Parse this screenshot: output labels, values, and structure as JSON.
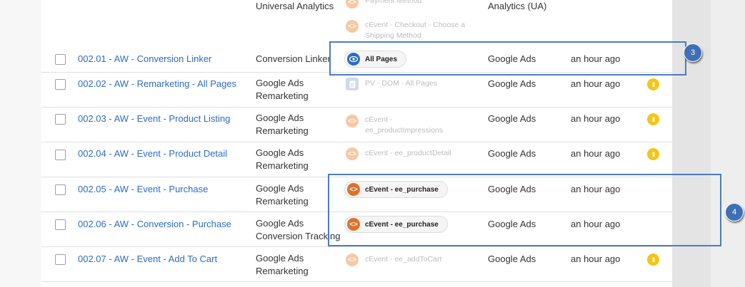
{
  "header_row": {
    "type": "Universal Analytics",
    "triggers": [
      "Payment Method",
      "cEvent - Checkout - Choose a Shipping Method"
    ],
    "destination": "Analytics (UA)"
  },
  "rows": [
    {
      "name": "002.01 - AW - Conversion Linker",
      "type": "Conversion Linker",
      "trigger": "All Pages",
      "destination": "Google Ads",
      "updated": "an hour ago"
    },
    {
      "name": "002.02 - AW - Remarketing - All Pages",
      "type": "Google Ads Remarketing",
      "trigger": "PV - DOM - All Pages",
      "destination": "Google Ads",
      "updated": "an hour ago",
      "status": "II"
    },
    {
      "name": "002.03 - AW - Event - Product Listing",
      "type": "Google Ads Remarketing",
      "trigger": "cEvent - ee_productImpressions",
      "destination": "Google Ads",
      "updated": "an hour ago",
      "status": "II"
    },
    {
      "name": "002.04 - AW - Event - Product Detail",
      "type": "Google Ads Remarketing",
      "trigger": "cEvent - ee_productDetail",
      "destination": "Google Ads",
      "updated": "an hour ago",
      "status": "II"
    },
    {
      "name": "002.05 - AW - Event - Purchase",
      "type": "Google Ads Remarketing",
      "trigger": "cEvent - ee_purchase",
      "destination": "Google Ads",
      "updated": "an hour ago"
    },
    {
      "name": "002.06 - AW - Conversion - Purchase",
      "type": "Google Ads Conversion Tracking",
      "trigger": "cEvent - ee_purchase",
      "destination": "Google Ads",
      "updated": "an hour ago"
    },
    {
      "name": "002.07 - AW - Event - Add To Cart",
      "type": "Google Ads Remarketing",
      "trigger": "cEvent - ee_addToCart",
      "destination": "Google Ads",
      "updated": "an hour ago",
      "status": "II"
    }
  ],
  "icons": {
    "eye": "eye-icon",
    "custom_event": "code-icon",
    "page_view": "document-icon",
    "paused": "pause-icon"
  },
  "callouts": {
    "first": "3",
    "second": "4"
  },
  "colors": {
    "link": "#2c6cc4",
    "custom_event": "#e0702a",
    "page_view_trigger": "#2c6cc4",
    "paused": "#f5c518",
    "callout": "#4a7cc0"
  }
}
